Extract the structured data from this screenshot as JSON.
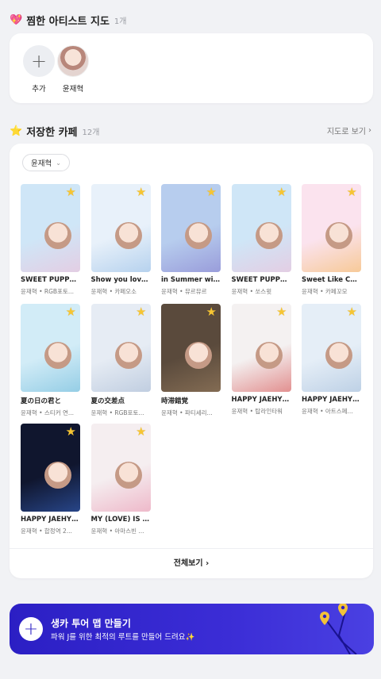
{
  "favorites": {
    "emoji": "💖",
    "title": "찜한 아티스트 지도",
    "count": "1개",
    "add_label": "추가",
    "add_icon": "+",
    "artists": [
      {
        "name": "윤재혁"
      }
    ]
  },
  "cafes": {
    "emoji": "⭐",
    "title": "저장한 카페",
    "count": "12개",
    "map_link": "지도로 보기",
    "map_link_icon": "›",
    "filter": {
      "value": "윤재혁",
      "icon": "⌄"
    },
    "items": [
      {
        "title": "SWEET PUPPY S...",
        "meta": "윤재혁 • RGB포토...",
        "bg": "#cfe6f7",
        "accent": "#f5b8d2"
      },
      {
        "title": "Show you love li...",
        "meta": "윤재혁 • 카페오소",
        "bg": "#e8f1fa",
        "accent": "#8ab6e3"
      },
      {
        "title": "in Summer with ...",
        "meta": "윤재혁 • 뮤르뮤르",
        "bg": "#b7cdee",
        "accent": "#7f72c9"
      },
      {
        "title": "SWEET PUPPY S...",
        "meta": "윤재혁 • 쏘스윗",
        "bg": "#cfe6f7",
        "accent": "#f5b8d2"
      },
      {
        "title": "Sweet Like Candy",
        "meta": "윤재혁 • 카페꼬모",
        "bg": "#fbe3ee",
        "accent": "#f3b34c"
      },
      {
        "title": "夏の日の君と",
        "meta": "윤재혁 • 스티커 연...",
        "bg": "#d2ecf7",
        "accent": "#5fb3d6"
      },
      {
        "title": "夏の交差点",
        "meta": "윤재혁 • RGB포토...",
        "bg": "#e6ecf4",
        "accent": "#9fb3cf"
      },
      {
        "title": "時滞錯覚",
        "meta": "윤재혁 • 파티세리...",
        "bg": "#5a4a3c",
        "accent": "#a88a68"
      },
      {
        "title": "HAPPY JAEHYU...",
        "meta": "윤재혁 • 탑라인타워",
        "bg": "#f4f1f1",
        "accent": "#d23a3a"
      },
      {
        "title": "HAPPY JAEHYU...",
        "meta": "윤재혁 • 아트스페...",
        "bg": "#e5eef7",
        "accent": "#9bb7d6"
      },
      {
        "title": "HAPPY JAEHYU...",
        "meta": "윤재혁 • 합정역 2...",
        "bg": "#10162e",
        "accent": "#3c6fd8"
      },
      {
        "title": "MY (LOVE) IS LI...",
        "meta": "윤재혁 • 아마스빈 ...",
        "bg": "#f5eef0",
        "accent": "#e88aa8"
      }
    ],
    "see_all": "전체보기",
    "see_all_icon": "›"
  },
  "banner": {
    "title": "생카 투어 맵 만들기",
    "subtitle": "파워 J를 위한 최적의 루트를 만들어 드려요✨",
    "icon": "+",
    "bg_color": "#2b1fc4",
    "pin_color": "#f2c23a"
  },
  "colors": {
    "star": "#f6c533",
    "page_bg": "#f1f2f5"
  }
}
